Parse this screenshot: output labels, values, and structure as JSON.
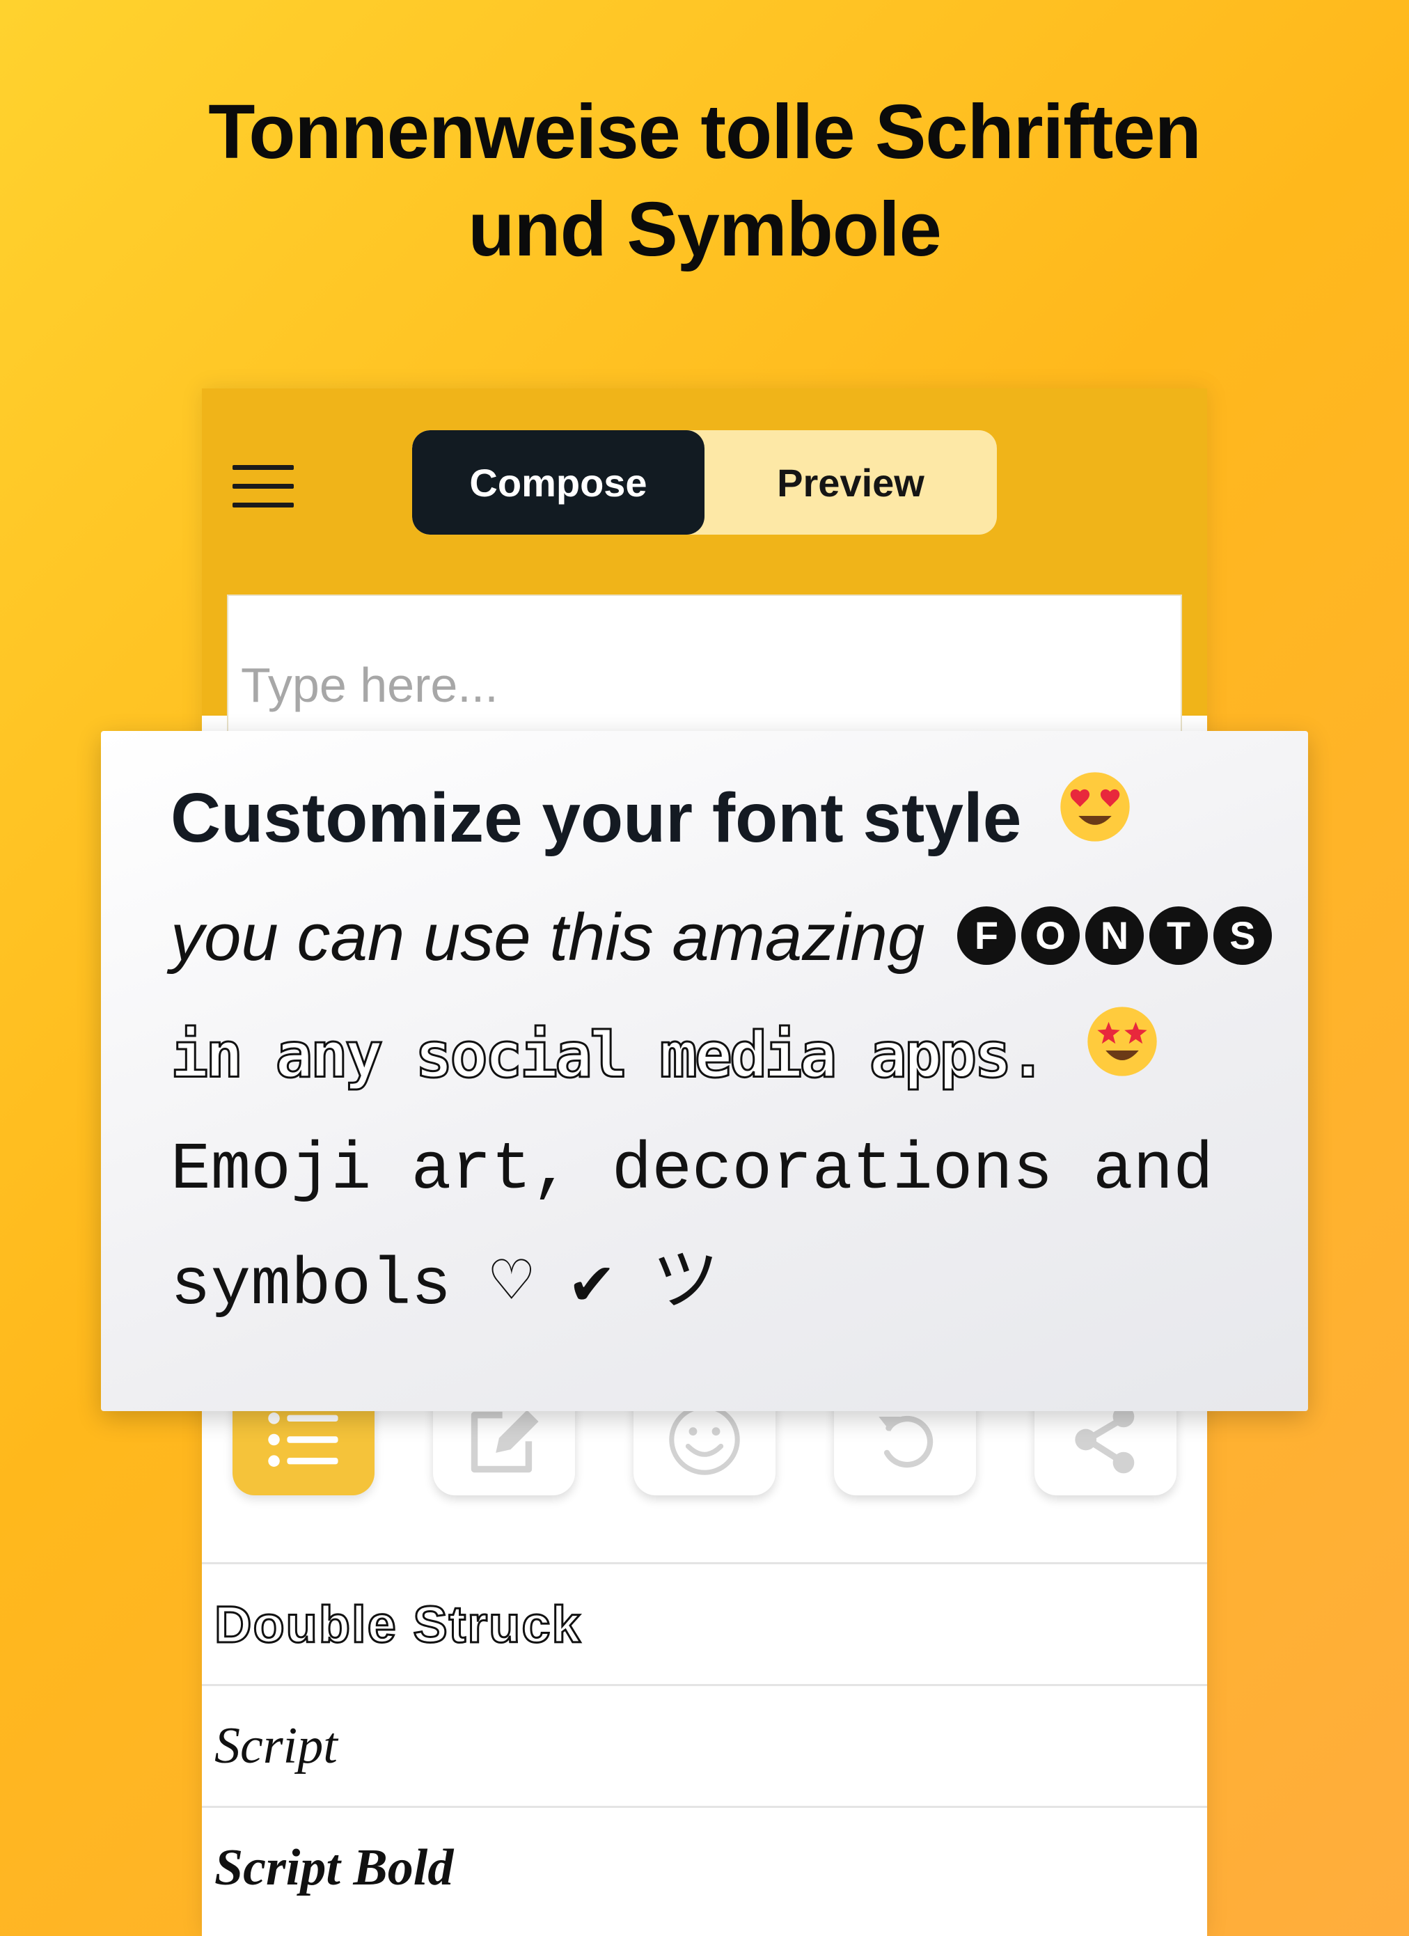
{
  "headline": {
    "line1": "Tonnenweise tolle Schriften",
    "line2": "und Symbole"
  },
  "appbar": {
    "tabs": {
      "compose": "Compose",
      "preview": "Preview"
    },
    "input_placeholder": "Type here..."
  },
  "card": {
    "line1": "Customize your font style",
    "line2_text": "you can use this amazing",
    "line2_letters": [
      "F",
      "O",
      "N",
      "T",
      "S"
    ],
    "line3": "in any social media apps.",
    "line4": "Emoji art, decorations and",
    "line5": "symbols ♡ ✔ ツ"
  },
  "toolbar": {
    "icons": [
      "list-icon",
      "edit-icon",
      "emoji-icon",
      "undo-icon",
      "share-icon"
    ],
    "active_color": "#f5c33a"
  },
  "fonts": {
    "items": [
      "Double Struck",
      "Script",
      "Script Bold"
    ]
  },
  "colors": {
    "appbar": "#f0b419",
    "compose_bg": "#121b22",
    "preview_bg": "#fde8a6"
  }
}
